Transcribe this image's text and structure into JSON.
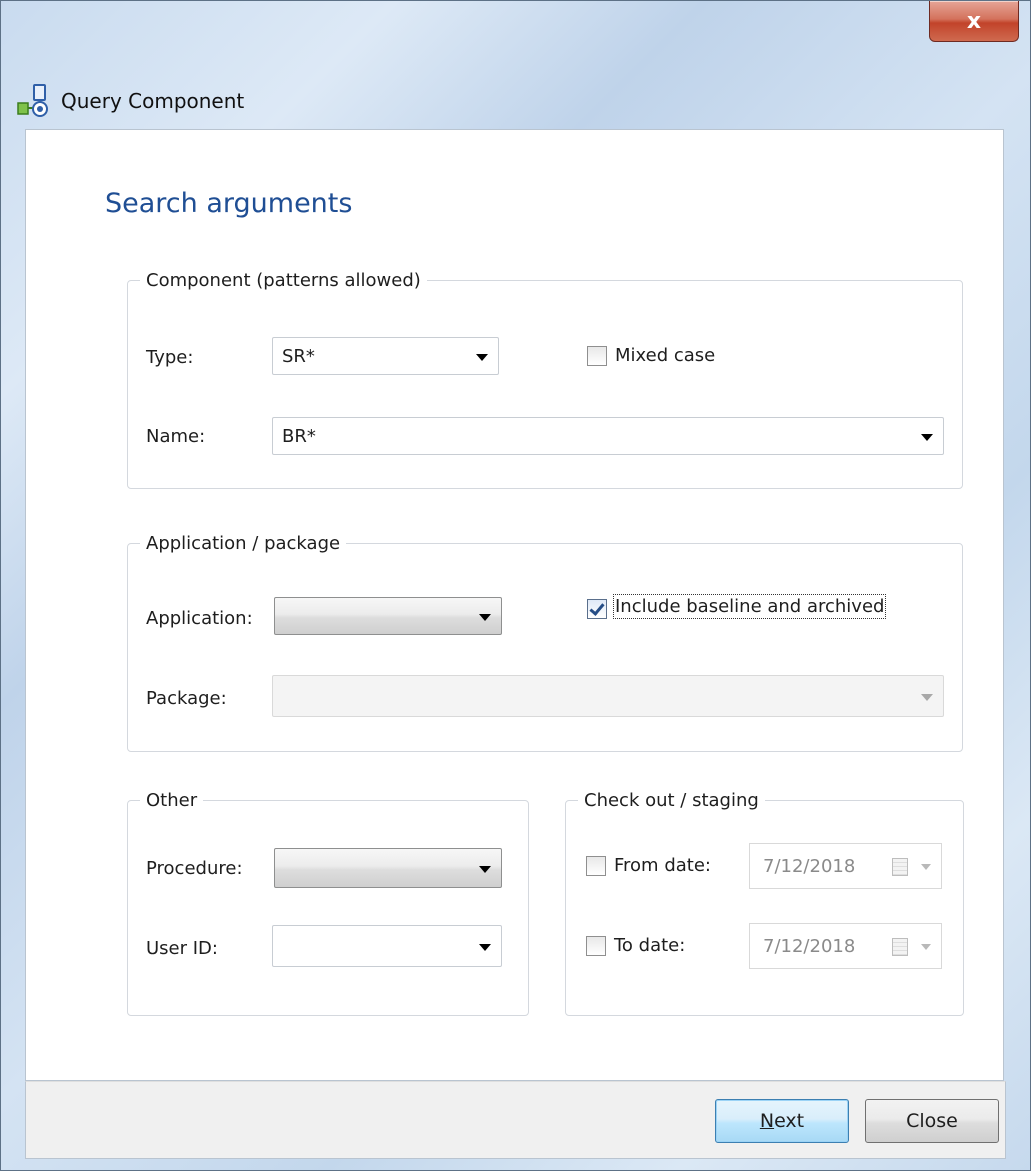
{
  "window": {
    "title": "Query Component",
    "close_glyph": "x",
    "app_icon": "query-component-icon"
  },
  "heading": "Search arguments",
  "component_group": {
    "legend": "Component (patterns allowed)",
    "type_label": "Type:",
    "type_value": "SR*",
    "mixed_case_label": "Mixed case",
    "mixed_case_checked": false,
    "name_label": "Name:",
    "name_value": "BR*"
  },
  "application_group": {
    "legend": "Application / package",
    "application_label": "Application:",
    "application_value": "",
    "include_label": "Include baseline and archived",
    "include_checked": true,
    "package_label": "Package:",
    "package_value": ""
  },
  "other_group": {
    "legend": "Other",
    "procedure_label": "Procedure:",
    "procedure_value": "",
    "user_id_label": "User ID:",
    "user_id_value": ""
  },
  "checkout_group": {
    "legend": "Check out / staging",
    "from_label": "From date:",
    "from_checked": false,
    "from_value": "7/12/2018",
    "to_label": "To date:",
    "to_checked": false,
    "to_value": "7/12/2018"
  },
  "buttons": {
    "next_mnemonic": "N",
    "next_rest": "ext",
    "close": "Close"
  },
  "colors": {
    "heading": "#1f4e94",
    "default_button": "#3c7fb1",
    "close_button": "#c2432a"
  }
}
